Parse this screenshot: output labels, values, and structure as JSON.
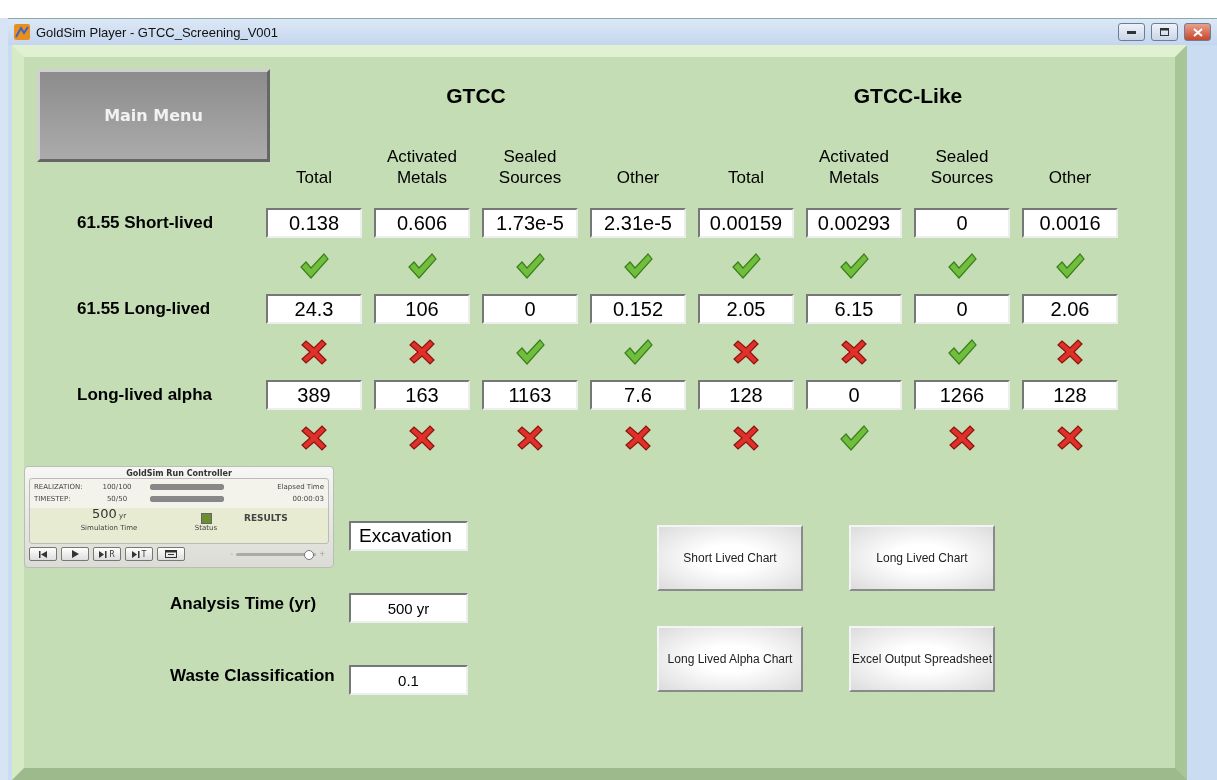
{
  "window": {
    "title": "GoldSim Player - GTCC_Screening_V001"
  },
  "main_menu": "Main Menu",
  "groups": [
    {
      "title": "GTCC"
    },
    {
      "title": "GTCC-Like"
    }
  ],
  "columns": [
    "Total",
    "Activated Metals",
    "Sealed Sources",
    "Other",
    "Total",
    "Activated Metals",
    "Sealed Sources",
    "Other"
  ],
  "rows": [
    {
      "label": "61.55 Short-lived",
      "cells": [
        {
          "value": "0.138",
          "pass": true
        },
        {
          "value": "0.606",
          "pass": true
        },
        {
          "value": "1.73e-5",
          "pass": true
        },
        {
          "value": "2.31e-5",
          "pass": true
        },
        {
          "value": "0.00159",
          "pass": true
        },
        {
          "value": "0.00293",
          "pass": true
        },
        {
          "value": "0",
          "pass": true
        },
        {
          "value": "0.0016",
          "pass": true
        }
      ]
    },
    {
      "label": "61.55 Long-lived",
      "cells": [
        {
          "value": "24.3",
          "pass": false
        },
        {
          "value": "106",
          "pass": false
        },
        {
          "value": "0",
          "pass": true
        },
        {
          "value": "0.152",
          "pass": true
        },
        {
          "value": "2.05",
          "pass": false
        },
        {
          "value": "6.15",
          "pass": false
        },
        {
          "value": "0",
          "pass": true
        },
        {
          "value": "2.06",
          "pass": false
        }
      ]
    },
    {
      "label": "Long-lived alpha",
      "cells": [
        {
          "value": "389",
          "pass": false
        },
        {
          "value": "163",
          "pass": false
        },
        {
          "value": "1163",
          "pass": false
        },
        {
          "value": "7.6",
          "pass": false
        },
        {
          "value": "128",
          "pass": false
        },
        {
          "value": "0",
          "pass": true
        },
        {
          "value": "1266",
          "pass": false
        },
        {
          "value": "128",
          "pass": false
        }
      ]
    }
  ],
  "run_controller": {
    "title": "GoldSim Run Controller",
    "progress": [
      {
        "label": "REALIZATION:",
        "count": "100/100",
        "level": 1
      },
      {
        "label": "TIMESTEP:",
        "count": "50/50",
        "level": 1
      }
    ],
    "elapsed_label": "Elapsed Time",
    "elapsed": "00:00:03",
    "sim_time": "500",
    "sim_unit": "yr",
    "sim_time_label": "Simulation Time",
    "status_label": "Status",
    "status_text": "RESULTS",
    "buttons": [
      {
        "kind": "rewind"
      },
      {
        "kind": "play"
      },
      {
        "kind": "step",
        "label": "R"
      },
      {
        "kind": "step",
        "label": "T"
      },
      {
        "kind": "window"
      }
    ],
    "speed": {
      "minus": "-",
      "plus": "+",
      "level": 0.9
    }
  },
  "scenario": "Excavation",
  "fields": [
    {
      "label": "Analysis Time (yr)",
      "value": "500 yr"
    },
    {
      "label": "Waste Classification",
      "value": "0.1"
    }
  ],
  "chart_buttons": [
    "Short Lived Chart",
    "Long Lived Chart",
    "Long Lived Alpha Chart",
    "Excel Output Spreadsheet"
  ]
}
